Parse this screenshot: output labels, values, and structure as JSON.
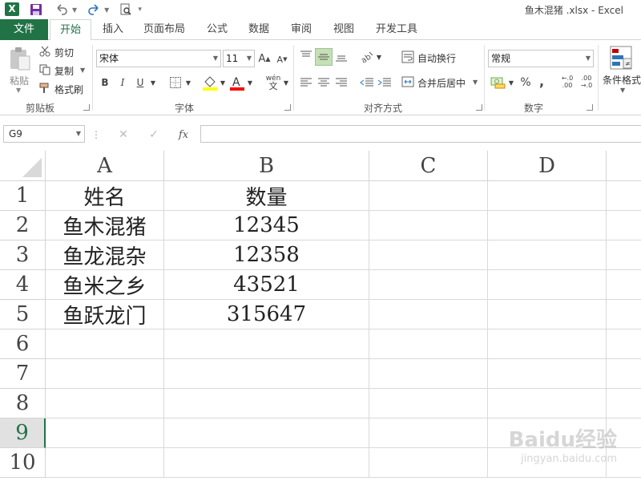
{
  "window": {
    "title": "鱼木混猪 .xlsx - Excel",
    "logo_letter": "X"
  },
  "tabs": {
    "file": "文件",
    "items": [
      "开始",
      "插入",
      "页面布局",
      "公式",
      "数据",
      "审阅",
      "视图",
      "开发工具"
    ],
    "active": "开始"
  },
  "ribbon": {
    "clipboard": {
      "paste": "粘贴",
      "cut": "剪切",
      "copy": "复制",
      "format_painter": "格式刷",
      "label": "剪贴板"
    },
    "font": {
      "name": "宋体",
      "size": "11",
      "bold": "B",
      "italic": "I",
      "underline": "U",
      "label": "字体"
    },
    "alignment": {
      "wrap_text": "自动换行",
      "merge_center": "合并后居中",
      "label": "对齐方式"
    },
    "number": {
      "format": "常规",
      "percent": "%",
      "comma": ",",
      "label": "数字"
    },
    "styles": {
      "conditional_format": "条件格式"
    }
  },
  "formula_bar": {
    "name_box": "G9",
    "fx": "fx",
    "value": ""
  },
  "sheet": {
    "columns": [
      "A",
      "B",
      "C",
      "D"
    ],
    "rows": [
      "1",
      "2",
      "3",
      "4",
      "5",
      "6",
      "7",
      "8",
      "9",
      "10"
    ],
    "selected_row": "9",
    "cells": [
      [
        "姓名",
        "数量"
      ],
      [
        "鱼木混猪",
        "12345"
      ],
      [
        "鱼龙混杂",
        "12358"
      ],
      [
        "鱼米之乡",
        "43521"
      ],
      [
        "鱼跃龙门",
        "315647"
      ]
    ]
  },
  "watermark": {
    "brand": "Baidu经验",
    "url": "jingyan.baidu.com"
  }
}
